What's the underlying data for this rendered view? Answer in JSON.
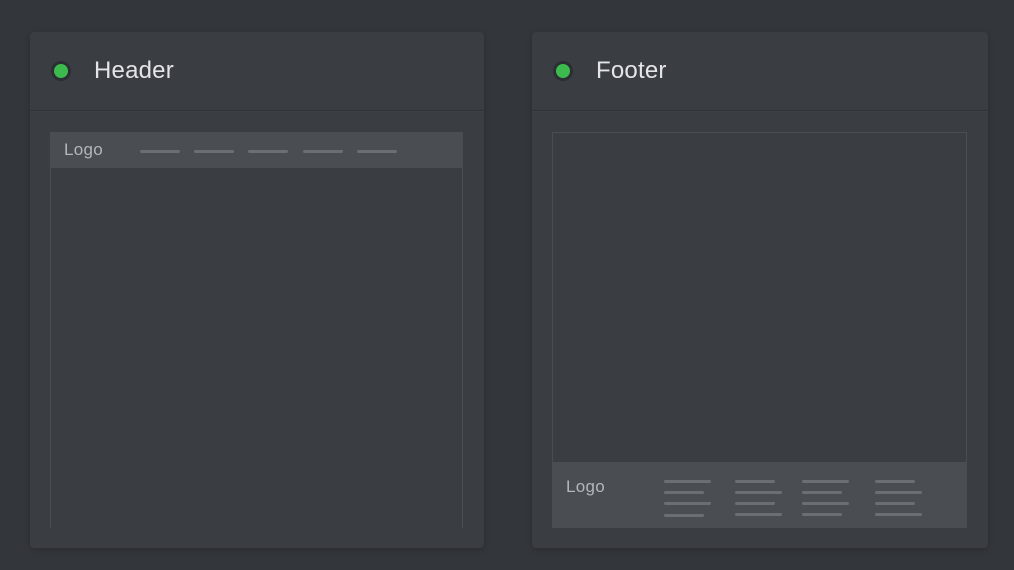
{
  "cards": [
    {
      "title": "Header",
      "status_color": "#3dba4e",
      "preview": {
        "bar_position": "top",
        "logo_label": "Logo",
        "nav_items": 5
      }
    },
    {
      "title": "Footer",
      "status_color": "#3dba4e",
      "preview": {
        "bar_position": "bottom",
        "logo_label": "Logo",
        "link_columns": 4
      }
    }
  ]
}
